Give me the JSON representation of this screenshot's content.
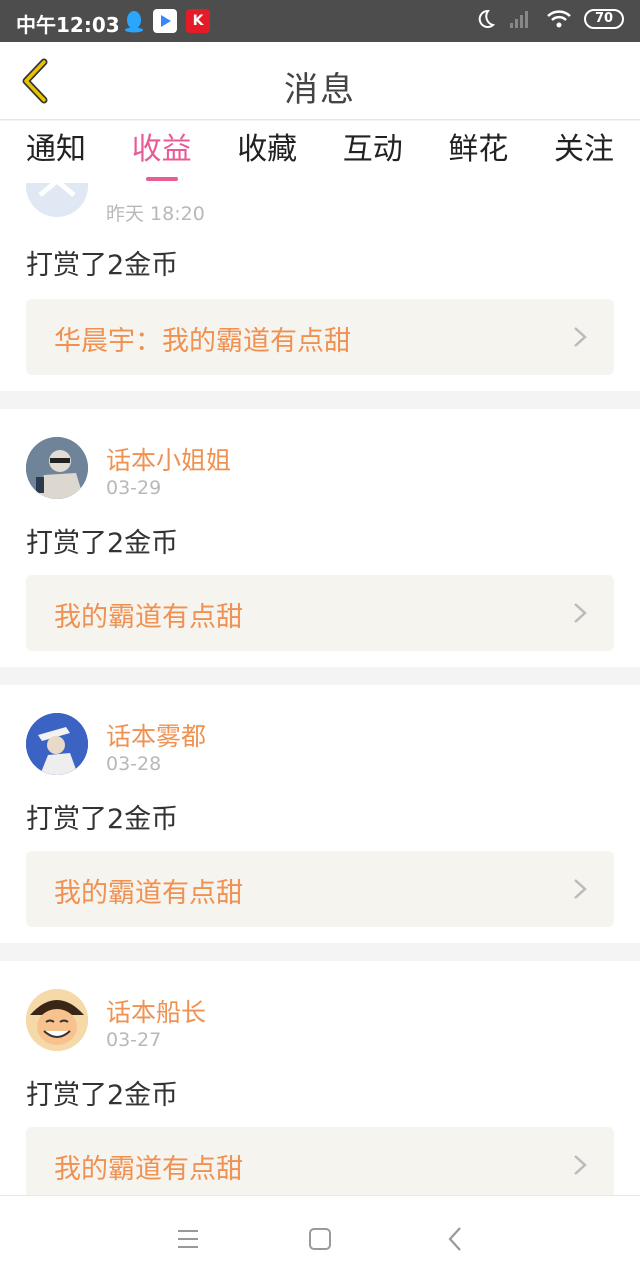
{
  "status_bar": {
    "time": "中午12:03",
    "battery": "70"
  },
  "header": {
    "title": "消息"
  },
  "tabs": [
    {
      "label": "通知"
    },
    {
      "label": "收益"
    },
    {
      "label": "收藏"
    },
    {
      "label": "互动"
    },
    {
      "label": "鲜花"
    },
    {
      "label": "关注"
    }
  ],
  "active_tab": "收益",
  "messages": [
    {
      "user": "",
      "date": "昨天 18:20",
      "action": "打赏了2金币",
      "book": "华晨宇：我的霸道有点甜"
    },
    {
      "user": "话本小姐姐",
      "date": "03-29",
      "action": "打赏了2金币",
      "book": "我的霸道有点甜"
    },
    {
      "user": "话本雾都",
      "date": "03-28",
      "action": "打赏了2金币",
      "book": "我的霸道有点甜"
    },
    {
      "user": "话本船长",
      "date": "03-27",
      "action": "打赏了2金币",
      "book": "我的霸道有点甜"
    }
  ],
  "colors": {
    "accent_pink": "#e95b97",
    "name_orange": "#f09152",
    "back_yellow": "#e8c300"
  }
}
